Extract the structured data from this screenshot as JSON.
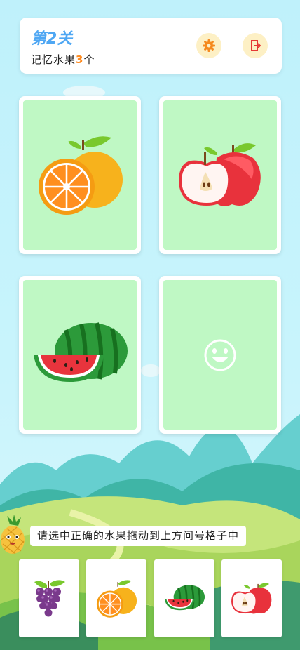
{
  "header": {
    "level_title": "第2关",
    "subtitle_prefix": "记忆水果",
    "subtitle_count": "3",
    "subtitle_suffix": "个",
    "settings_icon": "gear-icon",
    "exit_icon": "exit-door-icon"
  },
  "cards": [
    {
      "content": "orange"
    },
    {
      "content": "apple"
    },
    {
      "content": "watermelon"
    },
    {
      "content": "smiley-face-icon"
    }
  ],
  "hint": {
    "text": "请选中正确的水果拖动到上方问号格子中"
  },
  "options": [
    {
      "fruit": "grapes"
    },
    {
      "fruit": "orange"
    },
    {
      "fruit": "watermelon"
    },
    {
      "fruit": "apple"
    }
  ],
  "colors": {
    "title": "#4fa7f3",
    "count": "#ff8a1e",
    "card_bg": "#bff8c4",
    "button_bg": "#fdf0c5"
  }
}
